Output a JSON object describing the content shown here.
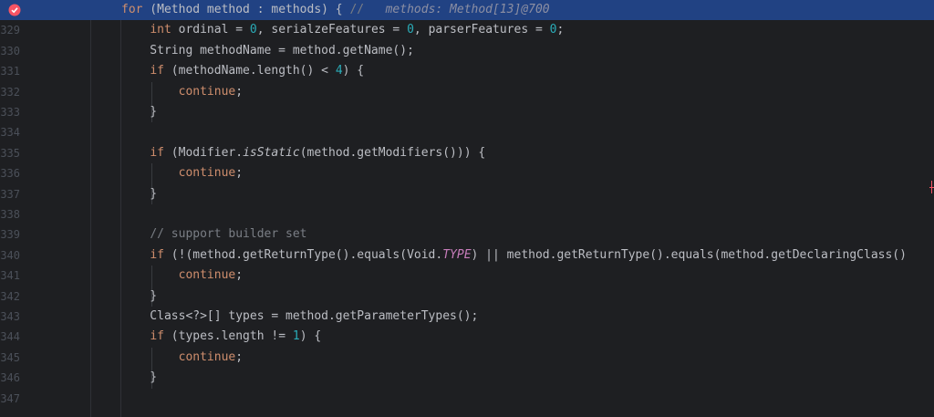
{
  "editor": {
    "lines": [
      {
        "num": "",
        "highlight": true,
        "breakpoint": true,
        "segments": [
          [
            "kw",
            "for"
          ],
          [
            "t",
            " (Method method : methods) { "
          ],
          [
            "cmt",
            "// "
          ],
          [
            "hint",
            "  methods: Method[13]@700"
          ]
        ]
      },
      {
        "num": "329",
        "segments": [
          [
            "t",
            "    "
          ],
          [
            "kw",
            "int"
          ],
          [
            "t",
            " ordinal = "
          ],
          [
            "num",
            "0"
          ],
          [
            "t",
            ", serialzeFeatures = "
          ],
          [
            "num",
            "0"
          ],
          [
            "t",
            ", parserFeatures = "
          ],
          [
            "num",
            "0"
          ],
          [
            "t",
            ";"
          ]
        ]
      },
      {
        "num": "330",
        "segments": [
          [
            "t",
            "    String methodName = method.getName();"
          ]
        ]
      },
      {
        "num": "331",
        "segments": [
          [
            "t",
            "    "
          ],
          [
            "kw",
            "if"
          ],
          [
            "t",
            " (methodName.length() < "
          ],
          [
            "num",
            "4"
          ],
          [
            "t",
            ") {"
          ]
        ]
      },
      {
        "num": "332",
        "segments": [
          [
            "t",
            "        "
          ],
          [
            "kw",
            "continue"
          ],
          [
            "t",
            ";"
          ]
        ]
      },
      {
        "num": "333",
        "segments": [
          [
            "t",
            "    }"
          ]
        ]
      },
      {
        "num": "334",
        "segments": []
      },
      {
        "num": "335",
        "segments": [
          [
            "t",
            "    "
          ],
          [
            "kw",
            "if"
          ],
          [
            "t",
            " (Modifier."
          ],
          [
            "ital",
            "isStatic"
          ],
          [
            "t",
            "(method.getModifiers())) {"
          ]
        ]
      },
      {
        "num": "336",
        "segments": [
          [
            "t",
            "        "
          ],
          [
            "kw",
            "continue"
          ],
          [
            "t",
            ";"
          ]
        ]
      },
      {
        "num": "337",
        "segments": [
          [
            "t",
            "    }"
          ]
        ]
      },
      {
        "num": "338",
        "segments": []
      },
      {
        "num": "339",
        "segments": [
          [
            "t",
            "    "
          ],
          [
            "cmt",
            "// support builder set"
          ]
        ]
      },
      {
        "num": "340",
        "segments": [
          [
            "t",
            "    "
          ],
          [
            "kw",
            "if"
          ],
          [
            "t",
            " (!(method.getReturnType().equals(Void."
          ],
          [
            "const",
            "TYPE"
          ],
          [
            "t",
            ") || method.getReturnType().equals(method.getDeclaringClass()"
          ]
        ]
      },
      {
        "num": "341",
        "segments": [
          [
            "t",
            "        "
          ],
          [
            "kw",
            "continue"
          ],
          [
            "t",
            ";"
          ]
        ]
      },
      {
        "num": "342",
        "segments": [
          [
            "t",
            "    }"
          ]
        ]
      },
      {
        "num": "343",
        "segments": [
          [
            "t",
            "    Class<?>[] types = method.getParameterTypes();"
          ]
        ]
      },
      {
        "num": "344",
        "segments": [
          [
            "t",
            "    "
          ],
          [
            "kw",
            "if"
          ],
          [
            "t",
            " (types.length != "
          ],
          [
            "num",
            "1"
          ],
          [
            "t",
            ") {"
          ]
        ]
      },
      {
        "num": "345",
        "segments": [
          [
            "t",
            "        "
          ],
          [
            "kw",
            "continue"
          ],
          [
            "t",
            ";"
          ]
        ]
      },
      {
        "num": "346",
        "segments": [
          [
            "t",
            "    }"
          ]
        ]
      },
      {
        "num": "347",
        "segments": []
      }
    ]
  },
  "colors": {
    "background": "#1e1f22",
    "highlight": "#214283",
    "keyword": "#cf8e6d",
    "number": "#2aacb8",
    "comment": "#7a7e85",
    "text": "#bcbec4",
    "breakpoint": "#f75464"
  },
  "icons": {
    "breakpoint": "breakpoint-icon"
  }
}
